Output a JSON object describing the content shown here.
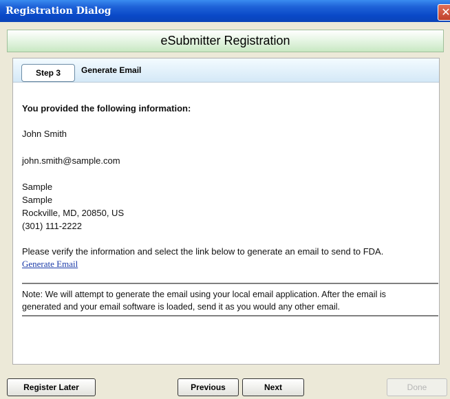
{
  "window": {
    "title": "Registration Dialog",
    "close_glyph": "✕"
  },
  "banner": {
    "title": "eSubmitter Registration"
  },
  "step": {
    "badge": "Step 3",
    "title": "Generate Email"
  },
  "content": {
    "heading": "You provided the following information:",
    "name": "John Smith",
    "email": "john.smith@sample.com",
    "address_lines": [
      "Sample",
      "Sample",
      "Rockville, MD, 20850, US",
      "(301) 111-2222"
    ],
    "instruction": "Please verify the information and select the link below to generate an email to send to FDA.",
    "link_label": "Generate Email",
    "note_line1": "Note: We will attempt to generate the email using your local email application. After the email is",
    "note_line2": "generated and your email software is loaded, send it as you would any other email."
  },
  "buttons": {
    "register_later": "Register Later",
    "previous": "Previous",
    "next": "Next",
    "done": "Done"
  }
}
